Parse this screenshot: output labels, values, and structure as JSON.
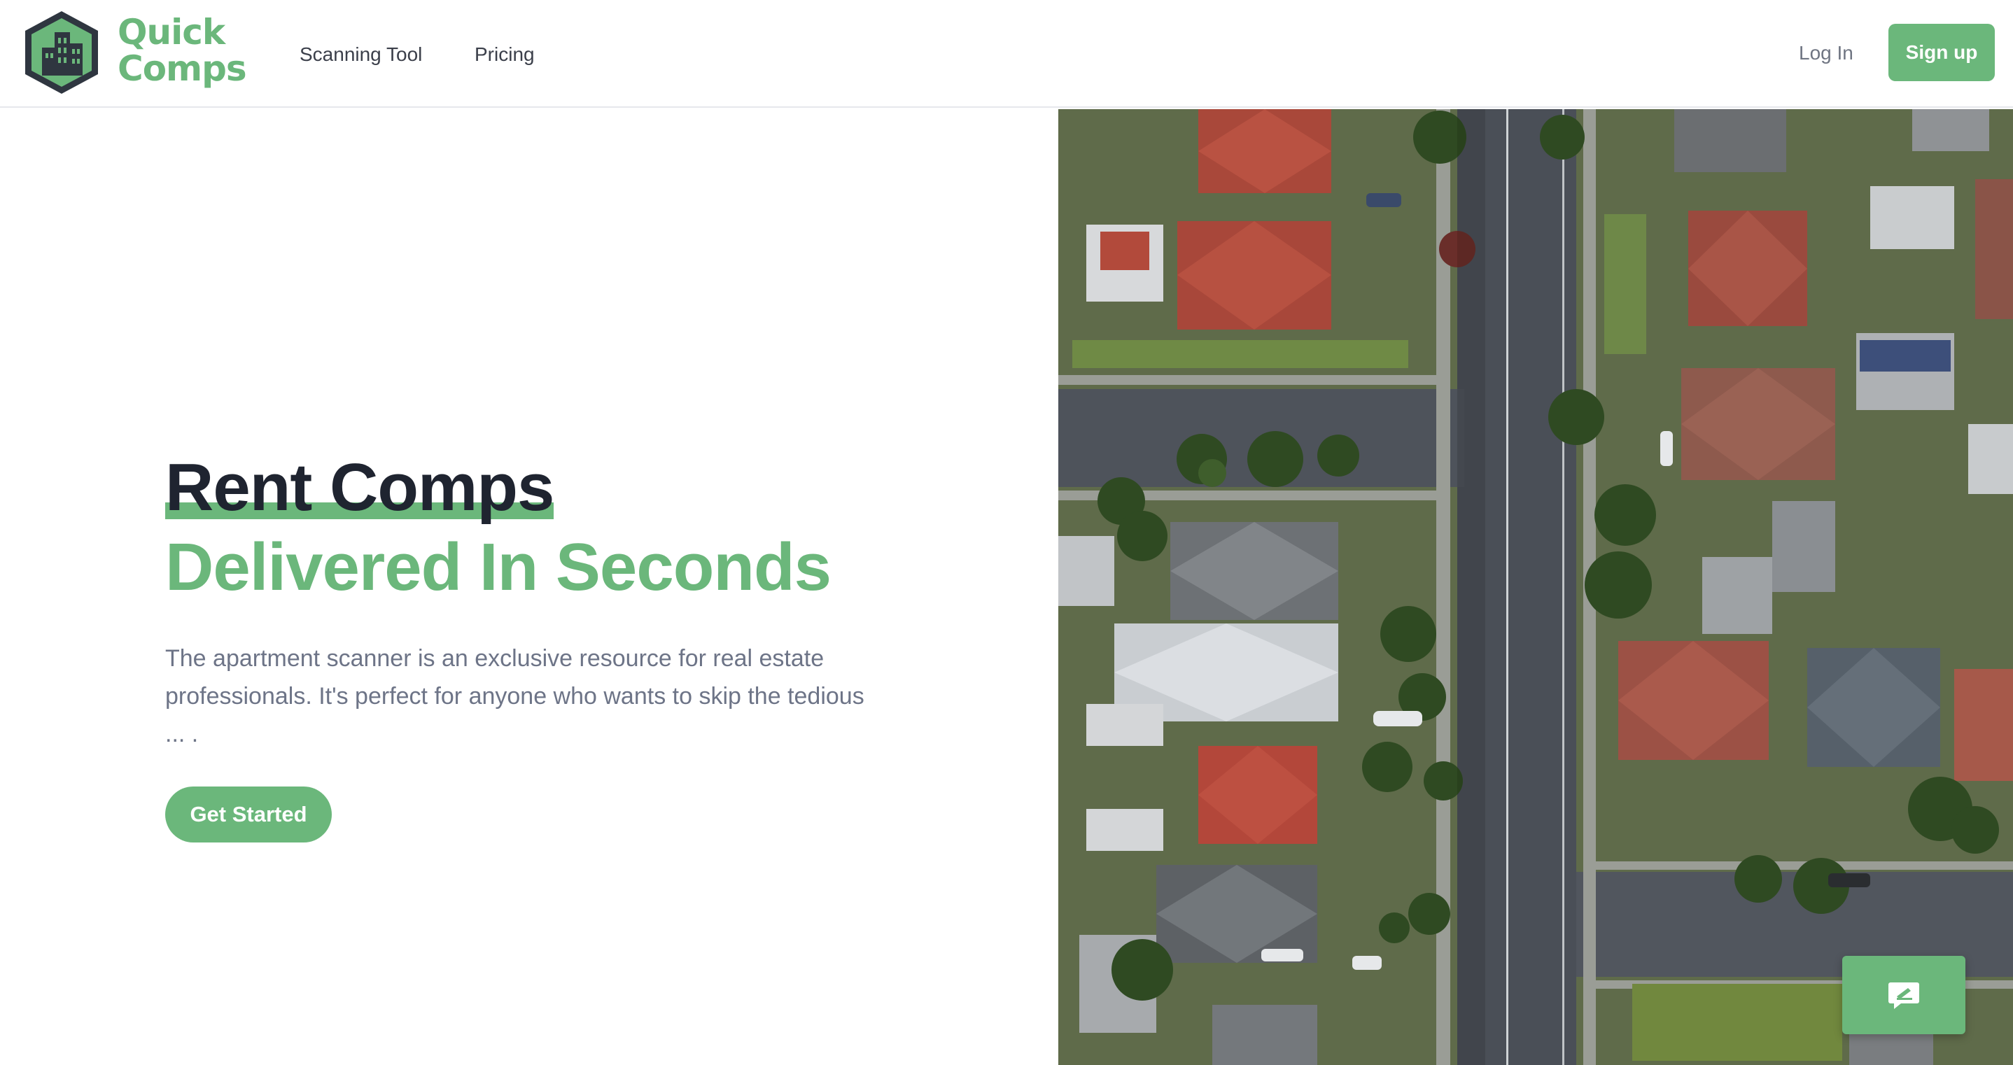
{
  "brand": {
    "name_line1": "Quick",
    "name_line2": "Comps",
    "color": "#6bb77b",
    "logo_icon": "building-hexagon-icon"
  },
  "nav": {
    "items": [
      {
        "label": "Scanning Tool"
      },
      {
        "label": "Pricing"
      }
    ]
  },
  "auth": {
    "login_label": "Log In",
    "signup_label": "Sign up"
  },
  "hero": {
    "title_line1": "Rent Comps",
    "title_line2": "Delivered In Seconds",
    "description": "The apartment scanner is an exclusive resource for real estate professionals. It's perfect for anyone who wants to skip the tedious ... .",
    "cta_label": "Get Started",
    "image_icon": "aerial-neighborhood-photo"
  },
  "feedback": {
    "icon": "feedback-icon"
  }
}
